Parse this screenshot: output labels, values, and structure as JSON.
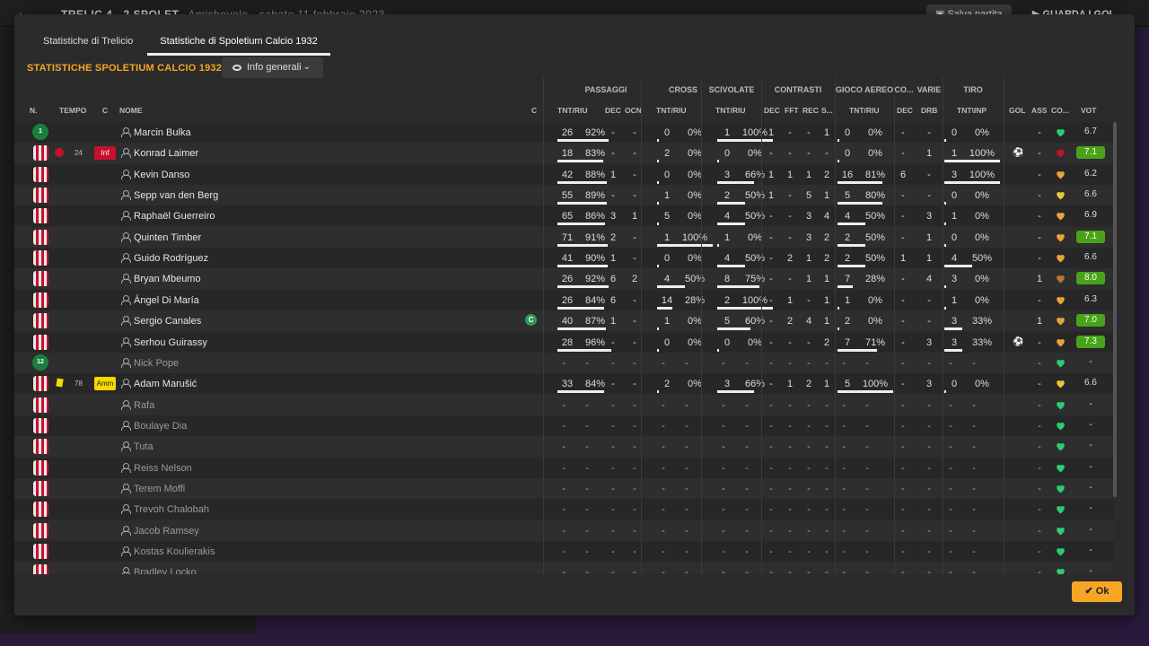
{
  "background": {
    "header": "TRELIC  4 - 2  SPOLET",
    "header_sub": "Amichevole  ·  sabato 11 febbraio 2023",
    "save_label": "Salva partita",
    "goals_label": "GUARDA I GOL"
  },
  "tabs": [
    "Statistiche di Trelicio",
    "Statistiche di Spoletium Calcio 1932"
  ],
  "section_title": "STATISTICHE SPOLETIUM CALCIO 1932",
  "view_select": "Info generali",
  "groups": {
    "passaggi": "PASSAGGI",
    "cross": "CROSS",
    "scivolate": "SCIVOLATE",
    "contrasti": "CONTRASTI",
    "aereo": "GIOCO AEREO",
    "co": "CO...",
    "varie": "VARIE",
    "tiro": "TIRO"
  },
  "columns": {
    "n": "N.",
    "tempo": "TEMPO",
    "c": "C",
    "nome": "NOME",
    "c2": "C",
    "pass": "TNT/RIU",
    "dec": "DEC",
    "ocn": "OCN",
    "cross": "TNT/RIU",
    "sciv": "TNT/RIU",
    "cdec": "DEC",
    "fft": "FFT",
    "rec": "REC",
    "s": "S...",
    "aer": "TNT/RIU",
    "codec": "DEC",
    "drb": "DRB",
    "tiro": "TNT\\INP",
    "gol": "GOL",
    "ass": "ASS",
    "co2": "CO...",
    "vot": "VOT"
  },
  "ok_label": "Ok",
  "players": [
    {
      "n": "1",
      "gk": true,
      "name": "Marcin Bulka",
      "used": true,
      "p": [
        "26",
        "92%"
      ],
      "pdec": "-",
      "ocn": "-",
      "cr": [
        "0",
        "0%"
      ],
      "sc": [
        "1",
        "100%"
      ],
      "cdec": "1",
      "fft": "-",
      "rec": "-",
      "s": "1",
      "ae": [
        "0",
        "0%"
      ],
      "codec": "-",
      "drb": "-",
      "ti": [
        "0",
        "0%"
      ],
      "gol": "",
      "ass": "-",
      "heart": "green",
      "vot": "6.7",
      "hi": false
    },
    {
      "n": "",
      "gk": false,
      "name": "Konrad Laimer",
      "used": true,
      "inj": true,
      "min": "24",
      "badge": "Inf",
      "p": [
        "18",
        "83%"
      ],
      "pdec": "-",
      "ocn": "-",
      "cr": [
        "2",
        "0%"
      ],
      "sc": [
        "0",
        "0%"
      ],
      "cdec": "-",
      "fft": "-",
      "rec": "-",
      "s": "-",
      "ae": [
        "0",
        "0%"
      ],
      "codec": "-",
      "drb": "1",
      "ti": [
        "1",
        "100%"
      ],
      "gol": "⚽",
      "ass": "-",
      "heart": "red",
      "vot": "7.1",
      "hi": true
    },
    {
      "n": "",
      "gk": false,
      "name": "Kevin Danso",
      "used": true,
      "p": [
        "42",
        "88%"
      ],
      "pdec": "1",
      "ocn": "-",
      "cr": [
        "0",
        "0%"
      ],
      "sc": [
        "3",
        "66%"
      ],
      "cdec": "1",
      "fft": "1",
      "rec": "1",
      "s": "2",
      "ae": [
        "16",
        "81%"
      ],
      "codec": "6",
      "drb": "-",
      "ti": [
        "3",
        "100%"
      ],
      "gol": "",
      "ass": "-",
      "heart": "orange",
      "vot": "6.2",
      "hi": false
    },
    {
      "n": "",
      "gk": false,
      "name": "Sepp van den Berg",
      "used": true,
      "p": [
        "55",
        "89%"
      ],
      "pdec": "-",
      "ocn": "-",
      "cr": [
        "1",
        "0%"
      ],
      "sc": [
        "2",
        "50%"
      ],
      "cdec": "1",
      "fft": "-",
      "rec": "5",
      "s": "1",
      "ae": [
        "5",
        "80%"
      ],
      "codec": "-",
      "drb": "-",
      "ti": [
        "0",
        "0%"
      ],
      "gol": "",
      "ass": "-",
      "heart": "yellow",
      "vot": "6.6",
      "hi": false
    },
    {
      "n": "",
      "gk": false,
      "name": "Raphaël Guerreiro",
      "used": true,
      "p": [
        "65",
        "86%"
      ],
      "pdec": "3",
      "ocn": "1",
      "cr": [
        "5",
        "0%"
      ],
      "sc": [
        "4",
        "50%"
      ],
      "cdec": "-",
      "fft": "-",
      "rec": "3",
      "s": "4",
      "ae": [
        "4",
        "50%"
      ],
      "codec": "-",
      "drb": "3",
      "ti": [
        "1",
        "0%"
      ],
      "gol": "",
      "ass": "-",
      "heart": "orange",
      "vot": "6.9",
      "hi": false
    },
    {
      "n": "",
      "gk": false,
      "name": "Quinten Timber",
      "used": true,
      "p": [
        "71",
        "91%"
      ],
      "pdec": "2",
      "ocn": "-",
      "cr": [
        "1",
        "100%"
      ],
      "sc": [
        "1",
        "0%"
      ],
      "cdec": "-",
      "fft": "-",
      "rec": "3",
      "s": "2",
      "ae": [
        "2",
        "50%"
      ],
      "codec": "-",
      "drb": "1",
      "ti": [
        "0",
        "0%"
      ],
      "gol": "",
      "ass": "-",
      "heart": "orange",
      "vot": "7.1",
      "hi": true
    },
    {
      "n": "",
      "gk": false,
      "name": "Guido Rodríguez",
      "used": true,
      "p": [
        "41",
        "90%"
      ],
      "pdec": "1",
      "ocn": "-",
      "cr": [
        "0",
        "0%"
      ],
      "sc": [
        "4",
        "50%"
      ],
      "cdec": "-",
      "fft": "2",
      "rec": "1",
      "s": "2",
      "ae": [
        "2",
        "50%"
      ],
      "codec": "1",
      "drb": "1",
      "ti": [
        "4",
        "50%"
      ],
      "gol": "",
      "ass": "-",
      "heart": "orange",
      "vot": "6.6",
      "hi": false
    },
    {
      "n": "",
      "gk": false,
      "name": "Bryan Mbeumo",
      "used": true,
      "p": [
        "26",
        "92%"
      ],
      "pdec": "6",
      "ocn": "2",
      "cr": [
        "4",
        "50%"
      ],
      "sc": [
        "8",
        "75%"
      ],
      "cdec": "-",
      "fft": "-",
      "rec": "1",
      "s": "1",
      "ae": [
        "7",
        "28%"
      ],
      "codec": "-",
      "drb": "4",
      "ti": [
        "3",
        "0%"
      ],
      "gol": "",
      "ass": "1",
      "heart": "brown",
      "vot": "8.0",
      "hi": true
    },
    {
      "n": "",
      "gk": false,
      "name": "Ángel Di María",
      "used": true,
      "p": [
        "26",
        "84%"
      ],
      "pdec": "6",
      "ocn": "-",
      "cr": [
        "14",
        "28%"
      ],
      "sc": [
        "2",
        "100%"
      ],
      "cdec": "-",
      "fft": "1",
      "rec": "-",
      "s": "1",
      "ae": [
        "1",
        "0%"
      ],
      "codec": "-",
      "drb": "-",
      "ti": [
        "1",
        "0%"
      ],
      "gol": "",
      "ass": "-",
      "heart": "orange",
      "vot": "6.3",
      "hi": false
    },
    {
      "n": "",
      "gk": false,
      "name": "Sergio Canales",
      "used": true,
      "captain": true,
      "p": [
        "40",
        "87%"
      ],
      "pdec": "1",
      "ocn": "-",
      "cr": [
        "1",
        "0%"
      ],
      "sc": [
        "5",
        "60%"
      ],
      "cdec": "-",
      "fft": "2",
      "rec": "4",
      "s": "1",
      "ae": [
        "2",
        "0%"
      ],
      "codec": "-",
      "drb": "-",
      "ti": [
        "3",
        "33%"
      ],
      "gol": "",
      "ass": "1",
      "heart": "orange",
      "vot": "7.0",
      "hi": true
    },
    {
      "n": "",
      "gk": false,
      "name": "Serhou Guirassy",
      "used": true,
      "p": [
        "28",
        "96%"
      ],
      "pdec": "-",
      "ocn": "-",
      "cr": [
        "0",
        "0%"
      ],
      "sc": [
        "0",
        "0%"
      ],
      "cdec": "-",
      "fft": "-",
      "rec": "-",
      "s": "2",
      "ae": [
        "7",
        "71%"
      ],
      "codec": "-",
      "drb": "3",
      "ti": [
        "3",
        "33%"
      ],
      "gol": "⚽",
      "ass": "-",
      "heart": "orange",
      "vot": "7.3",
      "hi": true
    },
    {
      "n": "12",
      "gk": true,
      "name": "Nick Pope",
      "used": false,
      "heart": "green",
      "vot": "-",
      "hi": false
    },
    {
      "n": "",
      "gk": false,
      "name": "Adam Marušić",
      "used": true,
      "ycard": true,
      "min": "78",
      "badge": "Amm",
      "p": [
        "33",
        "84%"
      ],
      "pdec": "-",
      "ocn": "-",
      "cr": [
        "2",
        "0%"
      ],
      "sc": [
        "3",
        "66%"
      ],
      "cdec": "-",
      "fft": "1",
      "rec": "2",
      "s": "1",
      "ae": [
        "5",
        "100%"
      ],
      "codec": "-",
      "drb": "3",
      "ti": [
        "0",
        "0%"
      ],
      "gol": "",
      "ass": "-",
      "heart": "yellow",
      "vot": "6.6",
      "hi": false
    },
    {
      "n": "",
      "gk": false,
      "name": "Rafa",
      "used": false,
      "heart": "green",
      "vot": "-",
      "hi": false
    },
    {
      "n": "",
      "gk": false,
      "name": "Boulaye Dia",
      "used": false,
      "heart": "green",
      "vot": "-",
      "hi": false
    },
    {
      "n": "",
      "gk": false,
      "name": "Tuta",
      "used": false,
      "heart": "green",
      "vot": "-",
      "hi": false
    },
    {
      "n": "",
      "gk": false,
      "name": "Reiss Nelson",
      "used": false,
      "heart": "green",
      "vot": "-",
      "hi": false
    },
    {
      "n": "",
      "gk": false,
      "name": "Terem Moffi",
      "used": false,
      "heart": "green",
      "vot": "-",
      "hi": false
    },
    {
      "n": "",
      "gk": false,
      "name": "Trevoh Chalobah",
      "used": false,
      "heart": "green",
      "vot": "-",
      "hi": false
    },
    {
      "n": "",
      "gk": false,
      "name": "Jacob Ramsey",
      "used": false,
      "heart": "green",
      "vot": "-",
      "hi": false
    },
    {
      "n": "",
      "gk": false,
      "name": "Kostas Koulierakis",
      "used": false,
      "heart": "green",
      "vot": "-",
      "hi": false
    },
    {
      "n": "",
      "gk": false,
      "name": "Bradley Locko",
      "used": false,
      "heart": "green",
      "vot": "-",
      "hi": false
    }
  ],
  "colors": {
    "accent": "#f6a623",
    "rating_high": "#49a31a",
    "heart_green": "#2ecc71",
    "heart_orange": "#e8a33c",
    "heart_yellow": "#e8c53c",
    "heart_brown": "#b9763a",
    "heart_red": "#c8102e"
  }
}
